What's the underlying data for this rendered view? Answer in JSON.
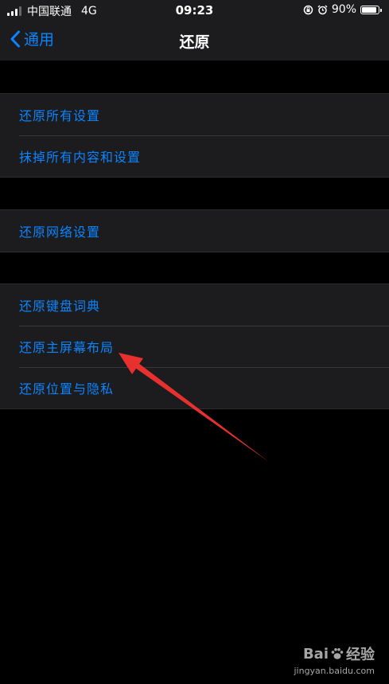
{
  "status_bar": {
    "carrier": "中国联通",
    "network": "4G",
    "time": "09:23",
    "battery_percent": "90%",
    "battery_level": 0.9
  },
  "nav": {
    "back_label": "通用",
    "title": "还原"
  },
  "groups": [
    {
      "items": [
        {
          "label": "还原所有设置"
        },
        {
          "label": "抹掉所有内容和设置"
        }
      ]
    },
    {
      "items": [
        {
          "label": "还原网络设置"
        }
      ]
    },
    {
      "items": [
        {
          "label": "还原键盘词典"
        },
        {
          "label": "还原主屏幕布局"
        },
        {
          "label": "还原位置与隐私"
        }
      ]
    }
  ],
  "watermark": {
    "brand": "Bai",
    "brand_suffix": "经验",
    "url": "jingyan.baidu.com"
  },
  "colors": {
    "accent": "#0a84ff",
    "annotation_arrow": "#e8312f"
  }
}
